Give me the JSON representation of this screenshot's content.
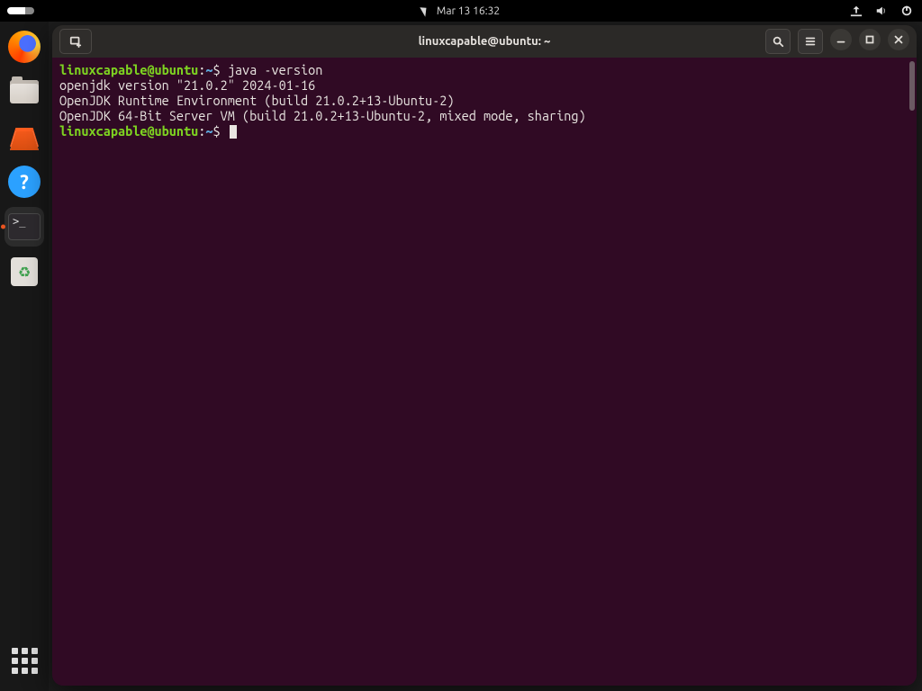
{
  "topbar": {
    "datetime": "Mar 13  16:32"
  },
  "dock": {
    "items": [
      {
        "name": "firefox",
        "label": "Firefox"
      },
      {
        "name": "files",
        "label": "Files"
      },
      {
        "name": "software",
        "label": "Ubuntu Software"
      },
      {
        "name": "help",
        "label": "Help",
        "glyph": "?"
      },
      {
        "name": "terminal",
        "label": "Terminal",
        "active": true
      },
      {
        "name": "trash",
        "label": "Trash"
      }
    ]
  },
  "window": {
    "title": "linuxcapable@ubuntu: ~"
  },
  "terminal": {
    "prompt_user": "linuxcapable@ubuntu",
    "prompt_sep1": ":",
    "prompt_path": "~",
    "prompt_sep2": "$ ",
    "lines": [
      {
        "type": "prompt",
        "command": "java -version"
      },
      {
        "type": "output",
        "text": "openjdk version \"21.0.2\" 2024-01-16"
      },
      {
        "type": "output",
        "text": "OpenJDK Runtime Environment (build 21.0.2+13-Ubuntu-2)"
      },
      {
        "type": "output",
        "text": "OpenJDK 64-Bit Server VM (build 21.0.2+13-Ubuntu-2, mixed mode, sharing)"
      },
      {
        "type": "prompt",
        "command": "",
        "cursor": true
      }
    ]
  }
}
